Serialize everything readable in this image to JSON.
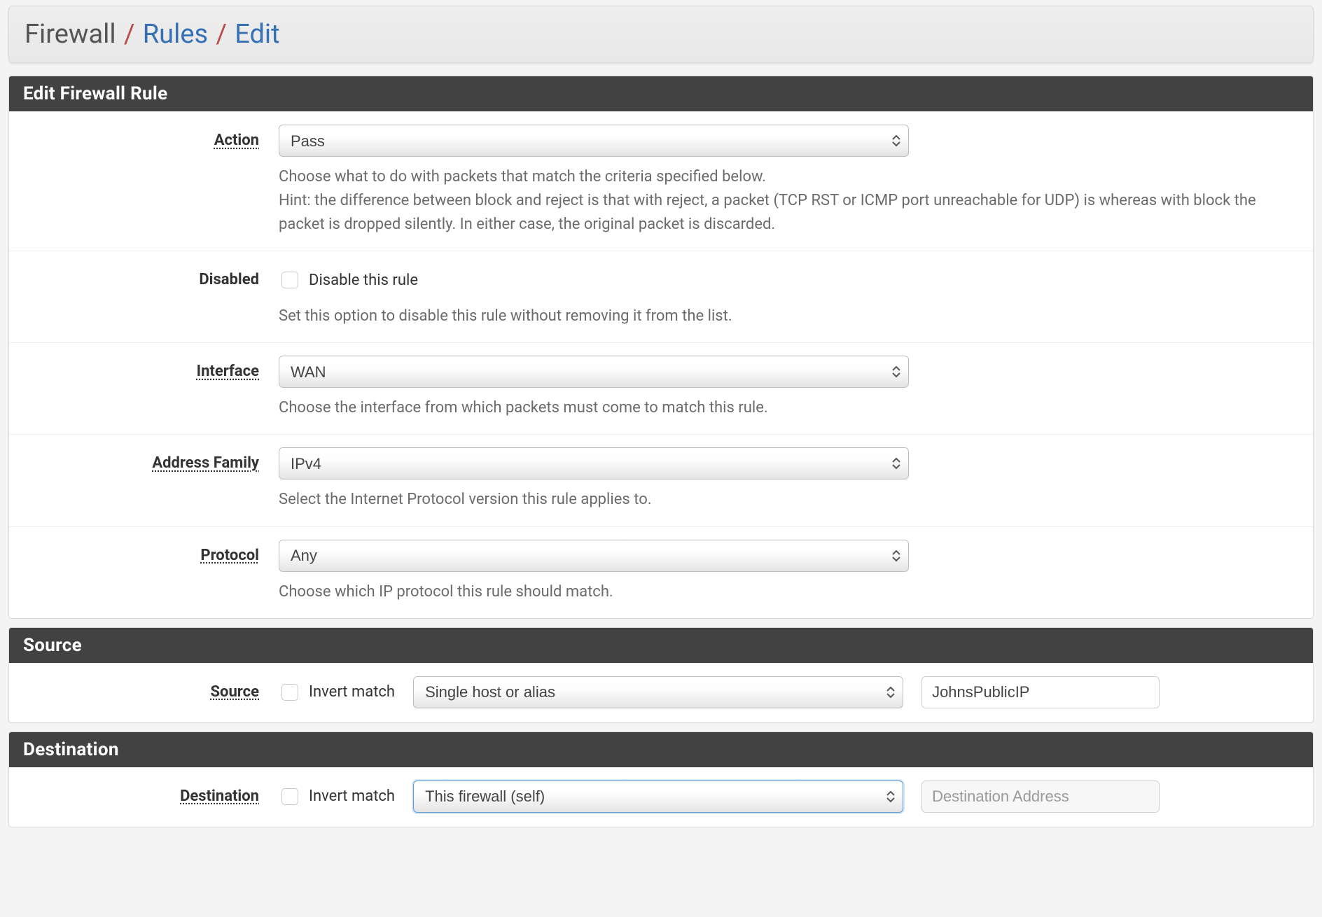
{
  "breadcrumb": {
    "root": "Firewall",
    "rules": "Rules",
    "edit": "Edit"
  },
  "panels": {
    "edit_title": "Edit Firewall Rule",
    "source_title": "Source",
    "destination_title": "Destination"
  },
  "fields": {
    "action": {
      "label": "Action",
      "value": "Pass",
      "help": "Choose what to do with packets that match the criteria specified below.\nHint: the difference between block and reject is that with reject, a packet (TCP RST or ICMP port unreachable for UDP) is whereas with block the packet is dropped silently. In either case, the original packet is discarded."
    },
    "disabled": {
      "label": "Disabled",
      "checkbox_label": "Disable this rule",
      "checked": false,
      "help": "Set this option to disable this rule without removing it from the list."
    },
    "interface": {
      "label": "Interface",
      "value": "WAN",
      "help": "Choose the interface from which packets must come to match this rule."
    },
    "address_family": {
      "label": "Address Family",
      "value": "IPv4",
      "help": "Select the Internet Protocol version this rule applies to."
    },
    "protocol": {
      "label": "Protocol",
      "value": "Any",
      "help": "Choose which IP protocol this rule should match."
    },
    "source": {
      "label": "Source",
      "invert_label": "Invert match",
      "invert_checked": false,
      "type_value": "Single host or alias",
      "address_value": "JohnsPublicIP"
    },
    "destination": {
      "label": "Destination",
      "invert_label": "Invert match",
      "invert_checked": false,
      "type_value": "This firewall (self)",
      "address_placeholder": "Destination Address"
    }
  }
}
